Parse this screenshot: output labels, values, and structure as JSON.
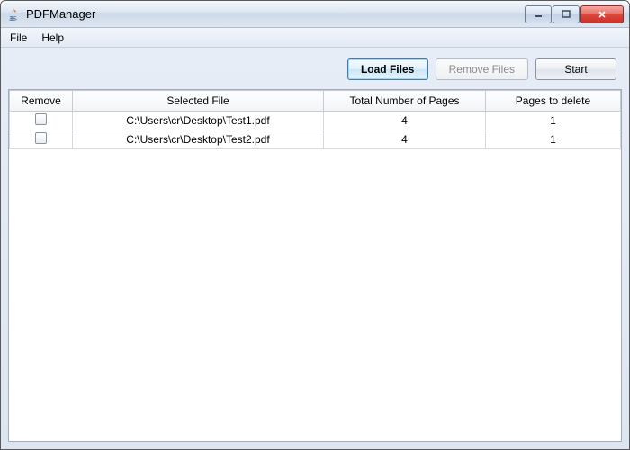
{
  "window": {
    "title": "PDFManager"
  },
  "menubar": {
    "file": "File",
    "help": "Help"
  },
  "toolbar": {
    "load": "Load Files",
    "remove": "Remove Files",
    "start": "Start"
  },
  "table": {
    "headers": {
      "remove": "Remove",
      "file": "Selected File",
      "pages": "Total Number of Pages",
      "delete": "Pages to delete"
    },
    "rows": [
      {
        "file": "C:\\Users\\cr\\Desktop\\Test1.pdf",
        "pages": "4",
        "delete": "1"
      },
      {
        "file": "C:\\Users\\cr\\Desktop\\Test2.pdf",
        "pages": "4",
        "delete": "1"
      }
    ]
  }
}
